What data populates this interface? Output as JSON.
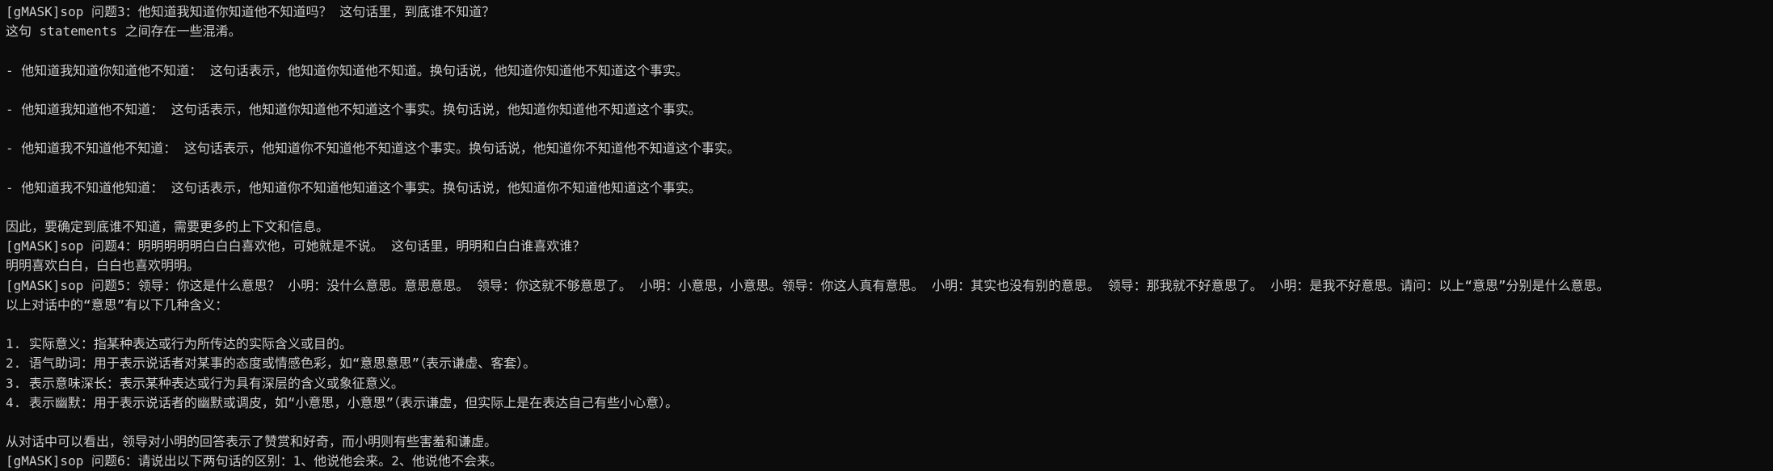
{
  "terminal": {
    "lines": [
      "[gMASK]sop 问题3：他知道我知道你知道他不知道吗？ 这句话里，到底谁不知道？",
      "这句 statements 之间存在一些混淆。",
      "",
      "- 他知道我知道你知道他不知道： 这句话表示，他知道你知道他不知道。换句话说，他知道你知道他不知道这个事实。",
      "",
      "- 他知道我知道他不知道： 这句话表示，他知道你知道他不知道这个事实。换句话说，他知道你知道他不知道这个事实。",
      "",
      "- 他知道我不知道他不知道： 这句话表示，他知道你不知道他不知道这个事实。换句话说，他知道你不知道他不知道这个事实。",
      "",
      "- 他知道我不知道他知道： 这句话表示，他知道你不知道他知道这个事实。换句话说，他知道你不知道他知道这个事实。",
      "",
      "因此，要确定到底谁不知道，需要更多的上下文和信息。",
      "[gMASK]sop 问题4：明明明明明白白白喜欢他，可她就是不说。 这句话里，明明和白白谁喜欢谁？",
      "明明喜欢白白，白白也喜欢明明。",
      "[gMASK]sop 问题5：领导：你这是什么意思？ 小明：没什么意思。意思意思。 领导：你这就不够意思了。 小明：小意思，小意思。领导：你这人真有意思。 小明：其实也没有别的意思。 领导：那我就不好意思了。 小明：是我不好意思。请问：以上“意思”分别是什么意思。",
      "以上对话中的“意思”有以下几种含义：",
      "",
      "1. 实际意义：指某种表达或行为所传达的实际含义或目的。",
      "2. 语气助词：用于表示说话者对某事的态度或情感色彩，如“意思意思”（表示谦虚、客套）。",
      "3. 表示意味深长：表示某种表达或行为具有深层的含义或象征意义。",
      "4. 表示幽默：用于表示说话者的幽默或调皮，如“小意思，小意思”（表示谦虚，但实际上是在表达自己有些小心意）。",
      "",
      "从对话中可以看出，领导对小明的回答表示了赞赏和好奇，而小明则有些害羞和谦虚。",
      "[gMASK]sop 问题6：请说出以下两句话的区别：1、他说他会来。2、他说他不会来。"
    ]
  }
}
